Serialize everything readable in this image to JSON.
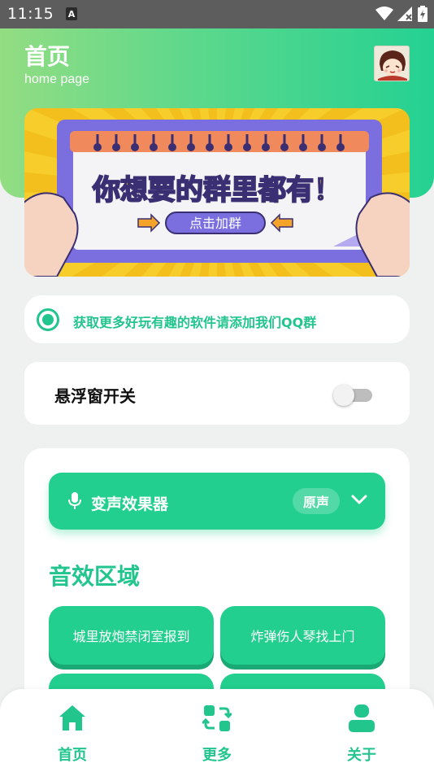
{
  "status_bar": {
    "time": "11:15",
    "notification_icon": "a-icon"
  },
  "header": {
    "title": "首页",
    "subtitle": "home page"
  },
  "banner": {
    "headline": "你想要的群里都有！",
    "cta": "点击加群"
  },
  "notice": {
    "text": "获取更多好玩有趣的软件请添加我们QQ群"
  },
  "float_window": {
    "label": "悬浮窗开关",
    "enabled": false
  },
  "voice_changer": {
    "label": "变声效果器",
    "selected": "原声"
  },
  "sound_section": {
    "title": "音效区域",
    "buttons": [
      "城里放炮禁闭室报到",
      "炸弹伤人琴找上门",
      "",
      ""
    ]
  },
  "bottom_nav": {
    "items": [
      {
        "label": "首页",
        "icon": "home-icon"
      },
      {
        "label": "更多",
        "icon": "refresh-grid-icon"
      },
      {
        "label": "关于",
        "icon": "user-icon"
      }
    ]
  },
  "colors": {
    "accent": "#22cf8f",
    "accent_text": "#22c58c",
    "banner_yellow": "#f6cd2a",
    "banner_purple": "#7b6fe0"
  }
}
